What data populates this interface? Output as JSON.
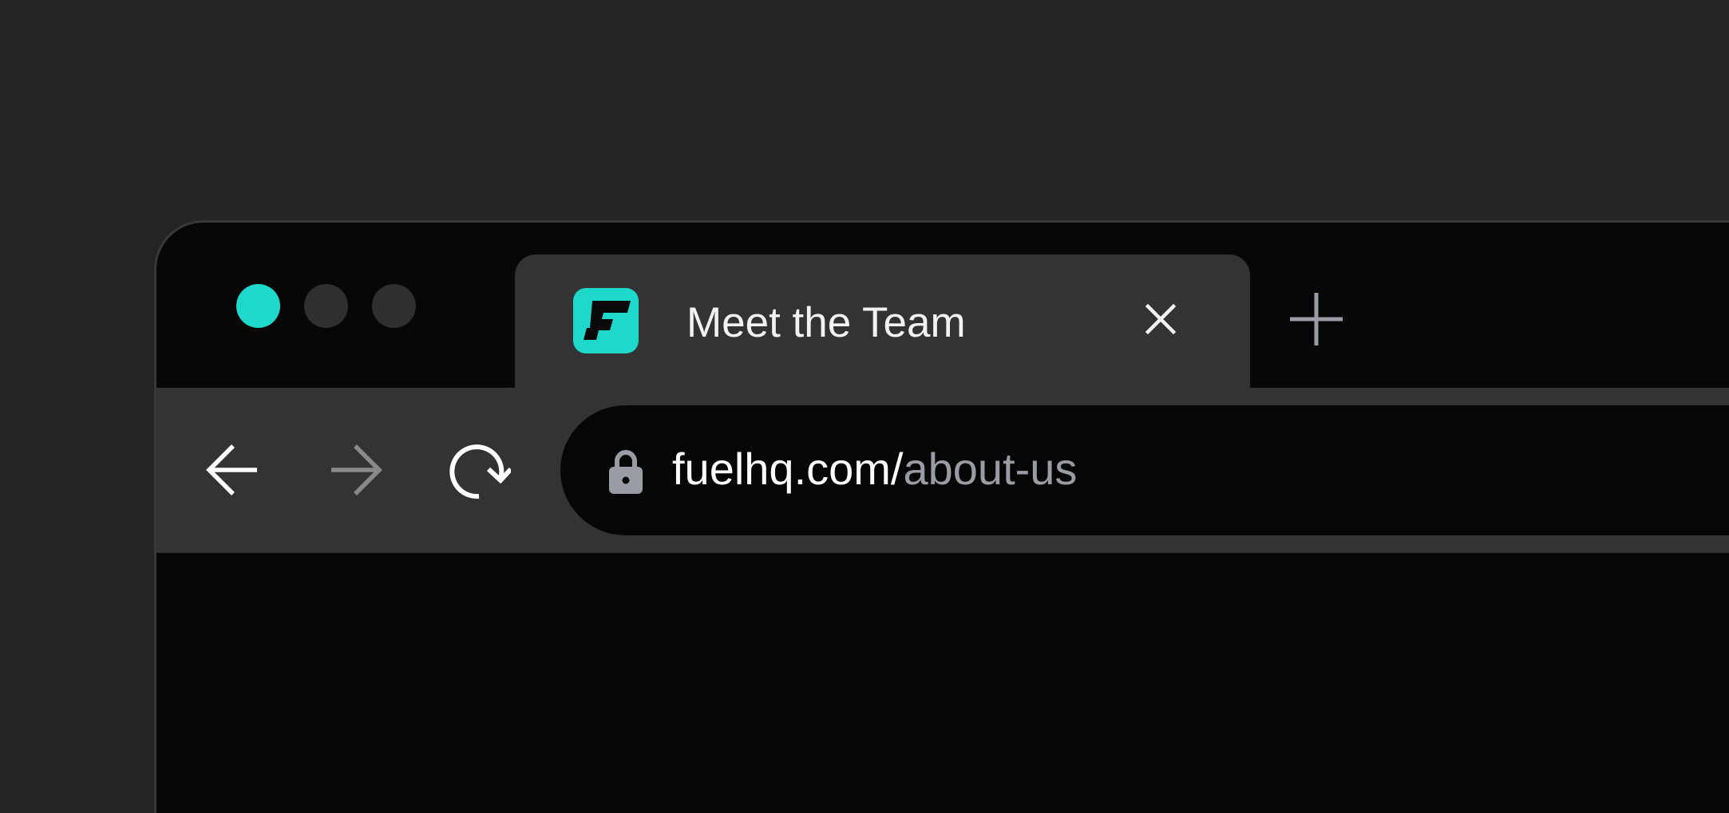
{
  "colors": {
    "accent": "#1ED8CB",
    "light_inactive": "#2F2F2F",
    "tab_background": "#333333",
    "address_background": "#060606",
    "url_path": "#9A9CA4"
  },
  "window_controls": [
    {
      "name": "close-window",
      "color": "#1ED8CB"
    },
    {
      "name": "minimize-window",
      "color": "#2F2F2F"
    },
    {
      "name": "zoom-window",
      "color": "#2F2F2F"
    }
  ],
  "tab": {
    "title": "Meet the Team",
    "favicon": "fuel-logo-icon",
    "close_icon": "close-icon"
  },
  "new_tab_icon": "plus-icon",
  "toolbar": {
    "back_icon": "arrow-left-icon",
    "forward_icon": "arrow-right-icon",
    "forward_enabled": false,
    "reload_icon": "reload-icon"
  },
  "address": {
    "lock_icon": "lock-icon",
    "host": "fuelhq.com/",
    "path": "about-us"
  }
}
